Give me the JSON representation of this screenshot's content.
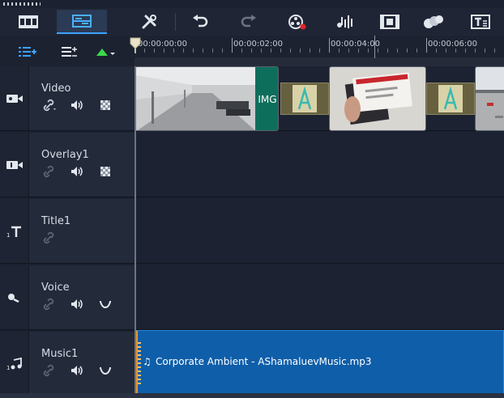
{
  "toolbar": {
    "items": [
      {
        "icon": "storyboard-view-icon"
      },
      {
        "icon": "timeline-view-icon",
        "active": true
      },
      {
        "icon": "toolbox-icon"
      },
      {
        "icon": "undo-icon"
      },
      {
        "icon": "redo-icon"
      },
      {
        "icon": "record-capture-icon"
      },
      {
        "icon": "sound-mixer-icon"
      },
      {
        "icon": "auto-music-icon"
      },
      {
        "icon": "mask-creator-icon"
      },
      {
        "icon": "title-editor-icon"
      }
    ]
  },
  "subbar": {
    "items": [
      {
        "icon": "track-manager-icon"
      },
      {
        "icon": "add-remove-chapter-icon"
      },
      {
        "icon": "ripple-editing-icon"
      }
    ]
  },
  "ruler": {
    "labels": [
      "00:00:00:00",
      "00:00:02:00",
      "00:00:04:00",
      "00:00:06:00"
    ]
  },
  "tracks": [
    {
      "name": "Video",
      "icon": "video-track-icon",
      "tools": [
        "link-icon",
        "volume-icon",
        "checker-icon"
      ]
    },
    {
      "name": "Overlay1",
      "icon": "overlay-track-icon",
      "tools": [
        "link-icon",
        "volume-icon",
        "checker-icon"
      ]
    },
    {
      "name": "Title1",
      "icon": "title-track-icon",
      "tools": [
        "link-icon"
      ]
    },
    {
      "name": "Voice",
      "icon": "voice-track-icon",
      "tools": [
        "link-icon",
        "volume-icon",
        "wave-icon"
      ]
    },
    {
      "name": "Music1",
      "icon": "music-track-icon",
      "tools": [
        "link-icon",
        "volume-icon",
        "wave-icon"
      ]
    }
  ],
  "video_clips": {
    "img_label": "IMG"
  },
  "music_clip": {
    "label": "Corporate Ambient - AShamaluevMusic.mp3"
  },
  "colors": {
    "accent": "#3ba3ff",
    "music_clip": "#0f5ea9",
    "clip_teal": "#0e6e5c",
    "music_edge": "#e8962a"
  }
}
